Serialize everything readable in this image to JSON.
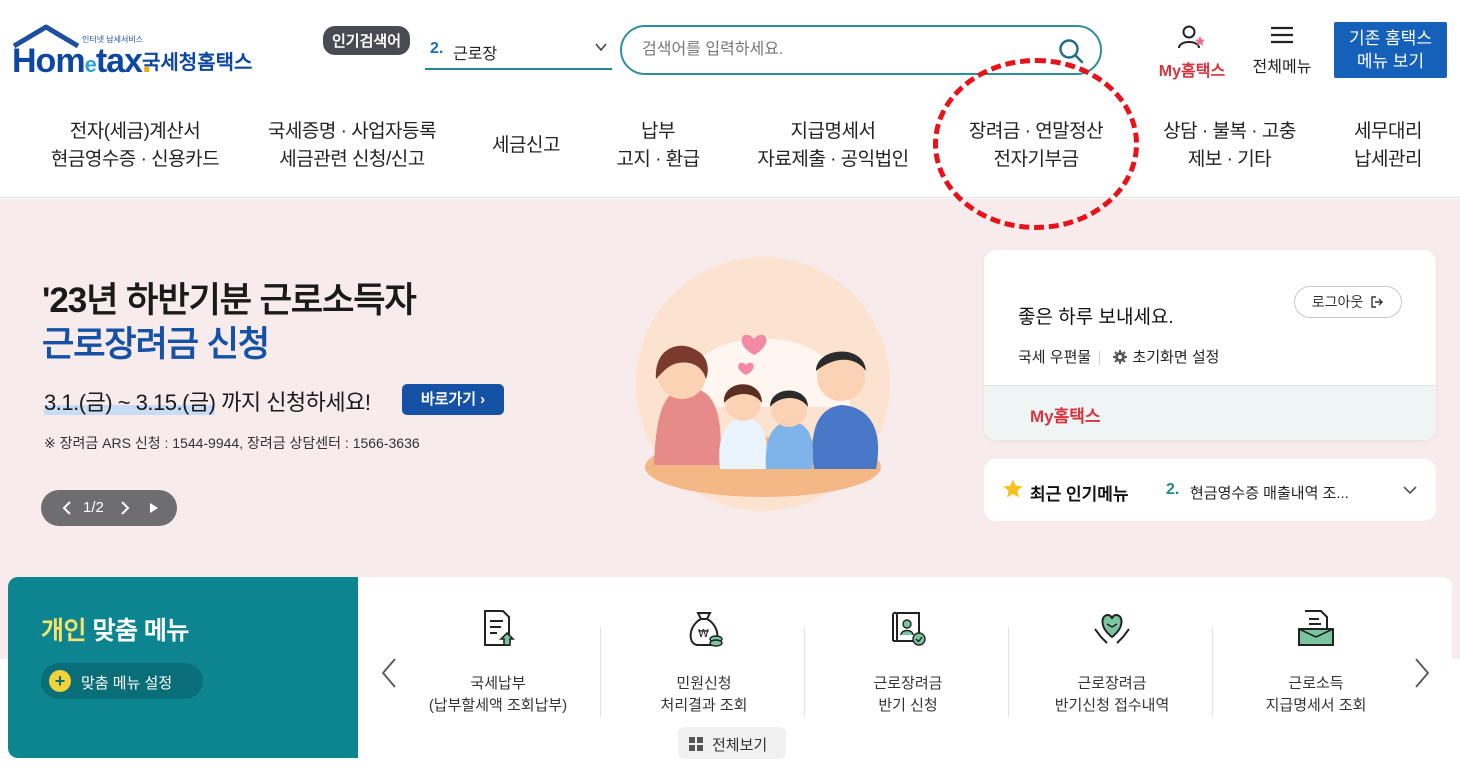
{
  "header": {
    "logo_tiny": "인터넷 납세서비스",
    "logo_brand": "Hom",
    "logo_brand_e": "e",
    "logo_brand_tax": "tax",
    "logo_dot": ".",
    "logo_korean": "국세청홈택스",
    "popular_badge": "인기검색어",
    "popular_num": "2.",
    "popular_text": "근로장",
    "search_placeholder": "검색어를 입력하세요.",
    "my_hometax": "My홈택스",
    "all_menu": "전체메뉴",
    "old_home_line1": "기존 홈택스",
    "old_home_line2": "메뉴 보기"
  },
  "nav": [
    {
      "line1": "전자(세금)계산서",
      "line2": "현금영수증 · 신용카드"
    },
    {
      "line1": "국세증명 · 사업자등록",
      "line2": "세금관련 신청/신고"
    },
    {
      "line1": "세금신고",
      "line2": ""
    },
    {
      "line1": "납부",
      "line2": "고지 · 환급"
    },
    {
      "line1": "지급명세서",
      "line2": "자료제출 · 공익법인"
    },
    {
      "line1": "장려금 · 연말정산",
      "line2": "전자기부금"
    },
    {
      "line1": "상담 · 불복 · 고충",
      "line2": "제보 · 기타"
    },
    {
      "line1": "세무대리",
      "line2": "납세관리"
    }
  ],
  "hero": {
    "title_line1": "'23년 하반기분 근로소득자",
    "title_line2": "근로장려금 신청",
    "period": "3.1.(금) ~ 3.15.(금)",
    "period_suffix": " 까지 신청하세요!",
    "go_button": "바로가기 ›",
    "note": "※ 장려금 ARS 신청 : 1544-9944, 장려금 상담센터 : 1566-3636",
    "pager_count": "1/2",
    "pager_current": 1,
    "pager_total": 2
  },
  "login": {
    "greeting": "좋은 하루 보내세요.",
    "logout": "로그아웃",
    "mailbox": "국세 우편물",
    "init_setting": "초기화면 설정",
    "my_hometax": "My홈택스"
  },
  "popular_menu": {
    "title": "최근 인기메뉴",
    "num": "2.",
    "text": "현금영수증 매출내역 조..."
  },
  "personal": {
    "title_highlight": "개인",
    "title_rest": " 맞춤 메뉴",
    "setting_button": "맞춤 메뉴 설정"
  },
  "quick_menu": [
    {
      "icon": "tax-payment-icon",
      "line1": "국세납부",
      "line2": "(납부할세액 조회납부)"
    },
    {
      "icon": "money-bag-icon",
      "line1": "민원신청",
      "line2": "처리결과 조회"
    },
    {
      "icon": "incentive-apply-icon",
      "line1": "근로장려금",
      "line2": "반기 신청"
    },
    {
      "icon": "heart-hands-icon",
      "line1": "근로장려금",
      "line2": "반기신청 접수내역"
    },
    {
      "icon": "statement-icon",
      "line1": "근로소득",
      "line2": "지급명세서 조회"
    }
  ],
  "view_all": "전체보기",
  "colors": {
    "brand_blue": "#1560b8",
    "teal": "#0c8590",
    "accent_red": "#d6343f",
    "annotation_red": "#e8131a",
    "hero_bg": "#f7ebeb"
  }
}
